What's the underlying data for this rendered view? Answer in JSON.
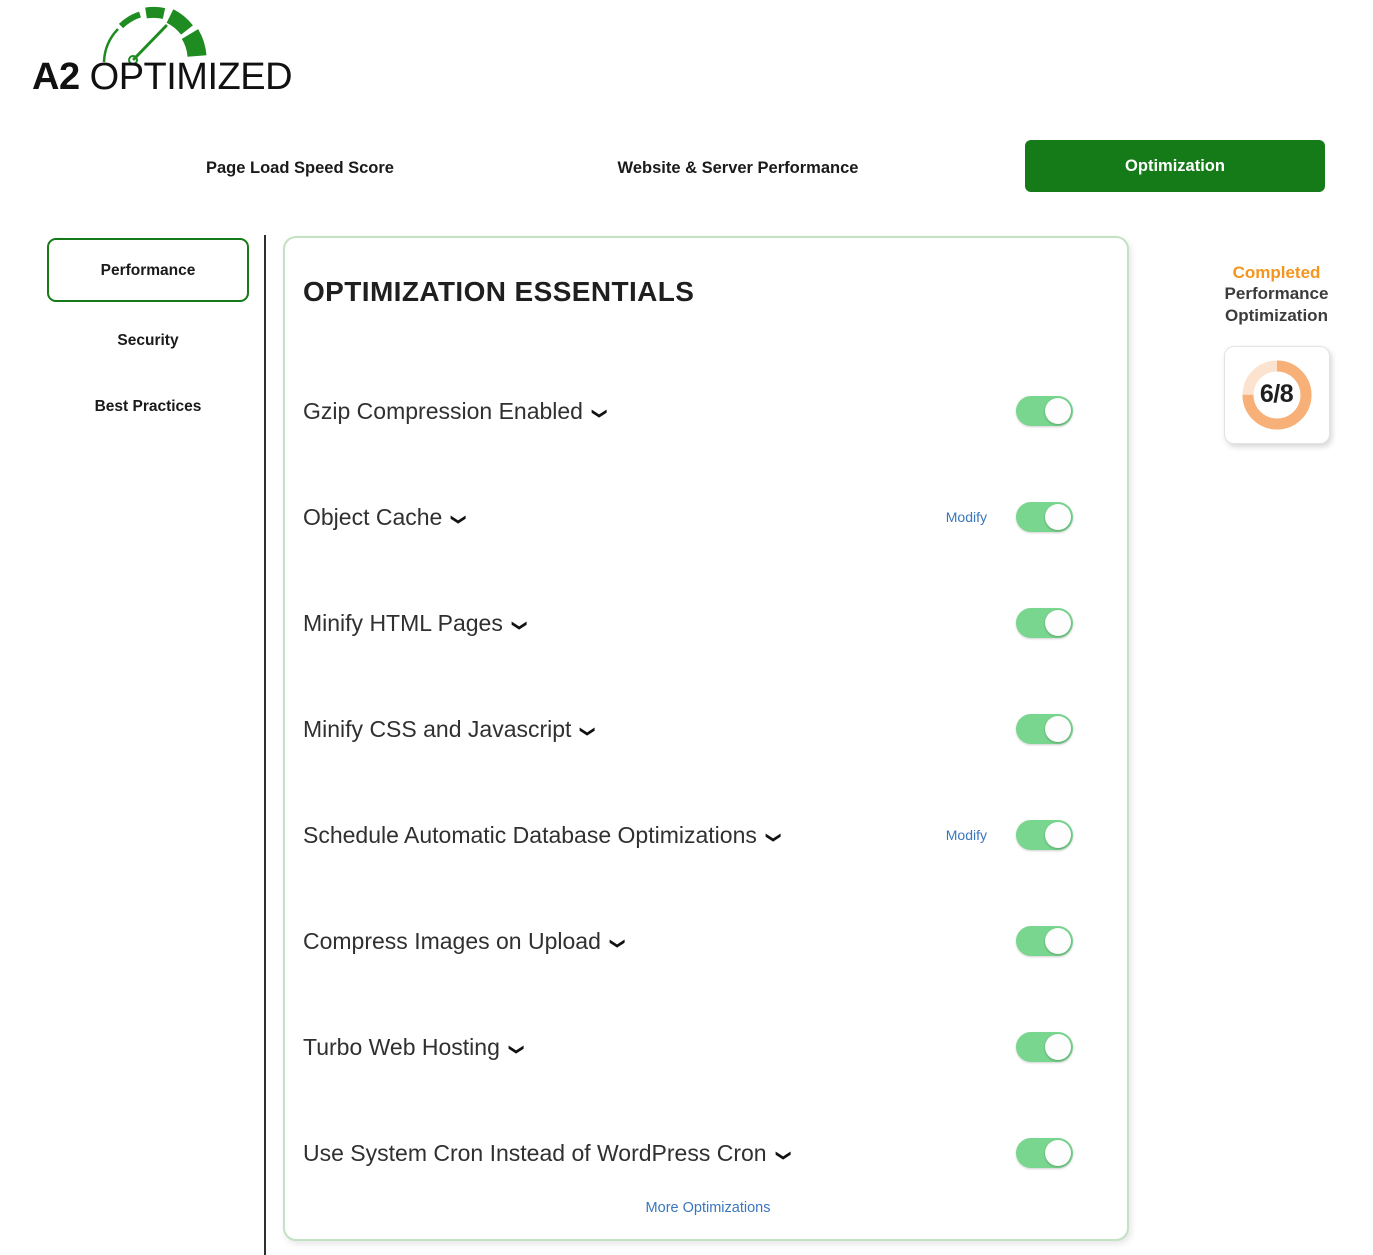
{
  "logo": {
    "primary": "A2",
    "secondary": " OPTIMIZED",
    "icon": "speedometer-gauge-icon",
    "color": "#1E8C20"
  },
  "header": {
    "tabs": [
      {
        "label": "Page Load Speed Score",
        "active": false
      },
      {
        "label": "Website & Server Performance",
        "active": false
      },
      {
        "label": "Optimization",
        "active": true
      }
    ],
    "active_color": "#157A18"
  },
  "sidebar": {
    "items": [
      {
        "label": "Performance",
        "active": true
      },
      {
        "label": "Security",
        "active": false
      },
      {
        "label": "Best Practices",
        "active": false
      }
    ]
  },
  "card": {
    "title": "OPTIMIZATION ESSENTIALS",
    "border_color": "#c3e2c3",
    "footer_link": "More Optimizations",
    "chevron_icon": "⌄",
    "rows": [
      {
        "label": "Gzip Compression Enabled",
        "modify": "",
        "enabled": true
      },
      {
        "label": "Object Cache",
        "modify": "Modify",
        "enabled": true
      },
      {
        "label": "Minify HTML Pages",
        "modify": "",
        "enabled": true
      },
      {
        "label": "Minify CSS and Javascript",
        "modify": "",
        "enabled": true
      },
      {
        "label": "Schedule Automatic Database Optimizations",
        "modify": "Modify",
        "enabled": true
      },
      {
        "label": "Compress Images on Upload",
        "modify": "",
        "enabled": true
      },
      {
        "label": "Turbo Web Hosting",
        "modify": "",
        "enabled": true
      },
      {
        "label": "Use System Cron Instead of WordPress Cron",
        "modify": "",
        "enabled": true
      }
    ]
  },
  "status_panel": {
    "status": "Completed",
    "subtitle_line1": "Performance",
    "subtitle_line2": "Optimization",
    "score": "6/8",
    "completed": 6,
    "total": 8,
    "percent": 75,
    "status_color": "#F5951E",
    "track_color": "#FBE3D0",
    "fill_color": "#F7B077"
  }
}
